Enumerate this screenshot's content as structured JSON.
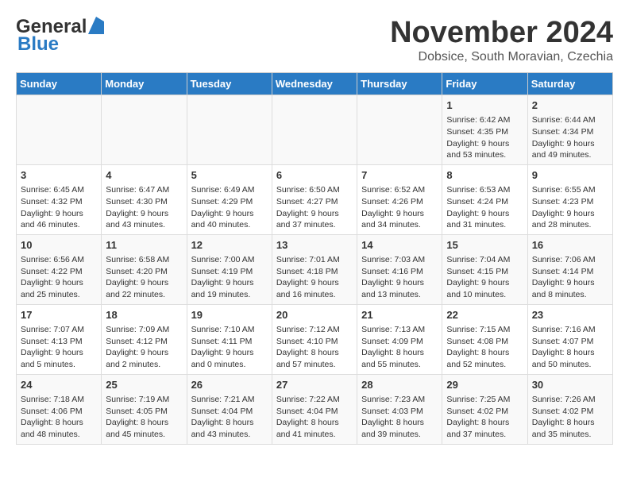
{
  "header": {
    "logo_line1": "General",
    "logo_line2": "Blue",
    "month": "November 2024",
    "location": "Dobsice, South Moravian, Czechia"
  },
  "weekdays": [
    "Sunday",
    "Monday",
    "Tuesday",
    "Wednesday",
    "Thursday",
    "Friday",
    "Saturday"
  ],
  "weeks": [
    [
      {
        "day": "",
        "info": ""
      },
      {
        "day": "",
        "info": ""
      },
      {
        "day": "",
        "info": ""
      },
      {
        "day": "",
        "info": ""
      },
      {
        "day": "",
        "info": ""
      },
      {
        "day": "1",
        "info": "Sunrise: 6:42 AM\nSunset: 4:35 PM\nDaylight: 9 hours and 53 minutes."
      },
      {
        "day": "2",
        "info": "Sunrise: 6:44 AM\nSunset: 4:34 PM\nDaylight: 9 hours and 49 minutes."
      }
    ],
    [
      {
        "day": "3",
        "info": "Sunrise: 6:45 AM\nSunset: 4:32 PM\nDaylight: 9 hours and 46 minutes."
      },
      {
        "day": "4",
        "info": "Sunrise: 6:47 AM\nSunset: 4:30 PM\nDaylight: 9 hours and 43 minutes."
      },
      {
        "day": "5",
        "info": "Sunrise: 6:49 AM\nSunset: 4:29 PM\nDaylight: 9 hours and 40 minutes."
      },
      {
        "day": "6",
        "info": "Sunrise: 6:50 AM\nSunset: 4:27 PM\nDaylight: 9 hours and 37 minutes."
      },
      {
        "day": "7",
        "info": "Sunrise: 6:52 AM\nSunset: 4:26 PM\nDaylight: 9 hours and 34 minutes."
      },
      {
        "day": "8",
        "info": "Sunrise: 6:53 AM\nSunset: 4:24 PM\nDaylight: 9 hours and 31 minutes."
      },
      {
        "day": "9",
        "info": "Sunrise: 6:55 AM\nSunset: 4:23 PM\nDaylight: 9 hours and 28 minutes."
      }
    ],
    [
      {
        "day": "10",
        "info": "Sunrise: 6:56 AM\nSunset: 4:22 PM\nDaylight: 9 hours and 25 minutes."
      },
      {
        "day": "11",
        "info": "Sunrise: 6:58 AM\nSunset: 4:20 PM\nDaylight: 9 hours and 22 minutes."
      },
      {
        "day": "12",
        "info": "Sunrise: 7:00 AM\nSunset: 4:19 PM\nDaylight: 9 hours and 19 minutes."
      },
      {
        "day": "13",
        "info": "Sunrise: 7:01 AM\nSunset: 4:18 PM\nDaylight: 9 hours and 16 minutes."
      },
      {
        "day": "14",
        "info": "Sunrise: 7:03 AM\nSunset: 4:16 PM\nDaylight: 9 hours and 13 minutes."
      },
      {
        "day": "15",
        "info": "Sunrise: 7:04 AM\nSunset: 4:15 PM\nDaylight: 9 hours and 10 minutes."
      },
      {
        "day": "16",
        "info": "Sunrise: 7:06 AM\nSunset: 4:14 PM\nDaylight: 9 hours and 8 minutes."
      }
    ],
    [
      {
        "day": "17",
        "info": "Sunrise: 7:07 AM\nSunset: 4:13 PM\nDaylight: 9 hours and 5 minutes."
      },
      {
        "day": "18",
        "info": "Sunrise: 7:09 AM\nSunset: 4:12 PM\nDaylight: 9 hours and 2 minutes."
      },
      {
        "day": "19",
        "info": "Sunrise: 7:10 AM\nSunset: 4:11 PM\nDaylight: 9 hours and 0 minutes."
      },
      {
        "day": "20",
        "info": "Sunrise: 7:12 AM\nSunset: 4:10 PM\nDaylight: 8 hours and 57 minutes."
      },
      {
        "day": "21",
        "info": "Sunrise: 7:13 AM\nSunset: 4:09 PM\nDaylight: 8 hours and 55 minutes."
      },
      {
        "day": "22",
        "info": "Sunrise: 7:15 AM\nSunset: 4:08 PM\nDaylight: 8 hours and 52 minutes."
      },
      {
        "day": "23",
        "info": "Sunrise: 7:16 AM\nSunset: 4:07 PM\nDaylight: 8 hours and 50 minutes."
      }
    ],
    [
      {
        "day": "24",
        "info": "Sunrise: 7:18 AM\nSunset: 4:06 PM\nDaylight: 8 hours and 48 minutes."
      },
      {
        "day": "25",
        "info": "Sunrise: 7:19 AM\nSunset: 4:05 PM\nDaylight: 8 hours and 45 minutes."
      },
      {
        "day": "26",
        "info": "Sunrise: 7:21 AM\nSunset: 4:04 PM\nDaylight: 8 hours and 43 minutes."
      },
      {
        "day": "27",
        "info": "Sunrise: 7:22 AM\nSunset: 4:04 PM\nDaylight: 8 hours and 41 minutes."
      },
      {
        "day": "28",
        "info": "Sunrise: 7:23 AM\nSunset: 4:03 PM\nDaylight: 8 hours and 39 minutes."
      },
      {
        "day": "29",
        "info": "Sunrise: 7:25 AM\nSunset: 4:02 PM\nDaylight: 8 hours and 37 minutes."
      },
      {
        "day": "30",
        "info": "Sunrise: 7:26 AM\nSunset: 4:02 PM\nDaylight: 8 hours and 35 minutes."
      }
    ]
  ]
}
